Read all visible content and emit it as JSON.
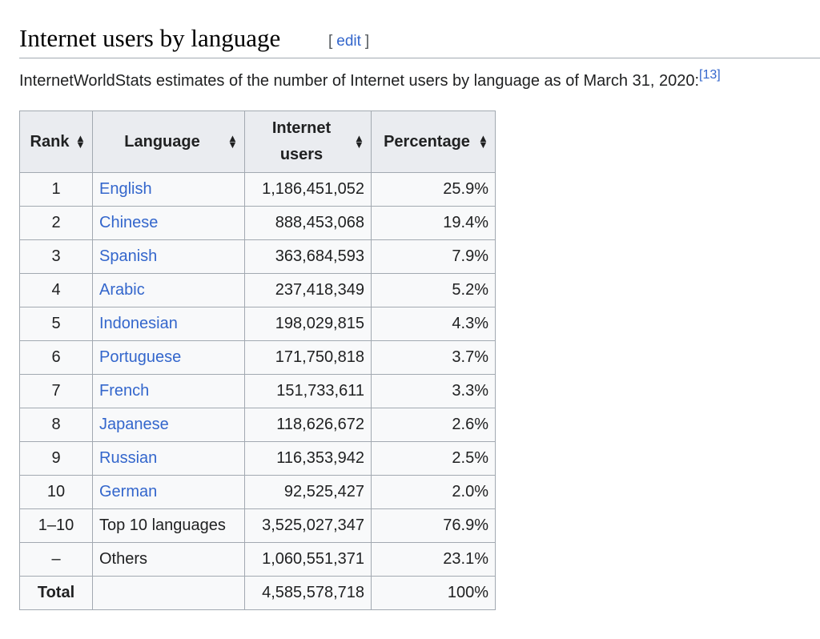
{
  "section": {
    "title": "Internet users by language",
    "edit_open": "[",
    "edit_label": "edit",
    "edit_close": "]"
  },
  "intro": {
    "text": "InternetWorldStats estimates of the number of Internet users by language as of March 31, 2020:",
    "citation": "[13]"
  },
  "table": {
    "headers": {
      "rank": "Rank",
      "language": "Language",
      "users_line1": "Internet",
      "users_line2": "users",
      "percentage": "Percentage"
    },
    "sort_icon": "sort-arrows-icon",
    "rows": [
      {
        "rank": "1",
        "language": "English",
        "users": "1,186,451,052",
        "pct": "25.9%"
      },
      {
        "rank": "2",
        "language": "Chinese",
        "users": "888,453,068",
        "pct": "19.4%"
      },
      {
        "rank": "3",
        "language": "Spanish",
        "users": "363,684,593",
        "pct": "7.9%"
      },
      {
        "rank": "4",
        "language": "Arabic",
        "users": "237,418,349",
        "pct": "5.2%"
      },
      {
        "rank": "5",
        "language": "Indonesian",
        "users": "198,029,815",
        "pct": "4.3%"
      },
      {
        "rank": "6",
        "language": "Portuguese",
        "users": "171,750,818",
        "pct": "3.7%"
      },
      {
        "rank": "7",
        "language": "French",
        "users": "151,733,611",
        "pct": "3.3%"
      },
      {
        "rank": "8",
        "language": "Japanese",
        "users": "118,626,672",
        "pct": "2.6%"
      },
      {
        "rank": "9",
        "language": "Russian",
        "users": "116,353,942",
        "pct": "2.5%"
      },
      {
        "rank": "10",
        "language": "German",
        "users": "92,525,427",
        "pct": "2.0%"
      }
    ],
    "summary_rows": [
      {
        "rank": "1–10",
        "language": "Top 10 languages",
        "users": "3,525,027,347",
        "pct": "76.9%"
      },
      {
        "rank": "–",
        "language": "Others",
        "users": "1,060,551,371",
        "pct": "23.1%"
      }
    ],
    "total": {
      "label": "Total",
      "language": "",
      "users": "4,585,578,718",
      "pct": "100%"
    }
  },
  "colors": {
    "link": "#3366cc",
    "header_bg": "#eaecf0",
    "table_bg": "#f8f9fa",
    "border": "#a2a9b1",
    "text": "#202122"
  }
}
